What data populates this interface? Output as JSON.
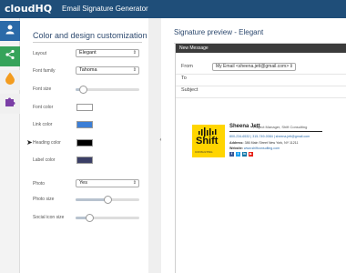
{
  "header": {
    "logo": "cloudHQ",
    "title": "Email Signature Generator"
  },
  "rail": {
    "items": [
      "user-icon",
      "share-icon",
      "droplet-icon",
      "puzzle-icon"
    ]
  },
  "panel": {
    "title": "Color and design customization",
    "fields": {
      "layout": {
        "label": "Layout",
        "value": "Elegant"
      },
      "font_family": {
        "label": "Font family",
        "value": "Tahoma"
      },
      "font_size": {
        "label": "Font size",
        "level": 0.12
      },
      "font_color": {
        "label": "Font color",
        "color": "#ffffff"
      },
      "link_color": {
        "label": "Link color",
        "color": "#3b7ed6"
      },
      "heading_color": {
        "label": "Heading color",
        "color": "#000000"
      },
      "label_color": {
        "label": "Label color",
        "color": "#3b3f66"
      },
      "photo": {
        "label": "Photo",
        "value": "Yes"
      },
      "photo_size": {
        "label": "Photo size",
        "level": 0.5
      },
      "social_icon_size": {
        "label": "Social icon size",
        "level": 0.22
      }
    }
  },
  "preview": {
    "title": "Signature preview - Elegant",
    "message": {
      "header": "New Message",
      "from_label": "From",
      "from_value": "My Email <sheena.jett@gmail.com>",
      "to_label": "To",
      "subject_label": "Subject"
    },
    "signature": {
      "logo_word": "Shift",
      "logo_sub": "CONSULTING",
      "name": "Sheena Jett",
      "role": "Project Manager, Shift Consulting",
      "contact": "800-234-6532 | 315-749-0084 | sheena.jett@gmail.com",
      "address_label": "Address:",
      "address_value": "386 Main Street New York, NY 11211",
      "website_label": "Website:",
      "website_value": "www.shiftconsulting.com",
      "social": [
        {
          "icon": "facebook-icon",
          "glyph": "f",
          "color": "#3b5998"
        },
        {
          "icon": "twitter-icon",
          "glyph": "t",
          "color": "#1da1f2"
        },
        {
          "icon": "linkedin-icon",
          "glyph": "in",
          "color": "#0e76a8"
        },
        {
          "icon": "youtube-icon",
          "glyph": "▶",
          "color": "#e62117"
        }
      ]
    }
  }
}
